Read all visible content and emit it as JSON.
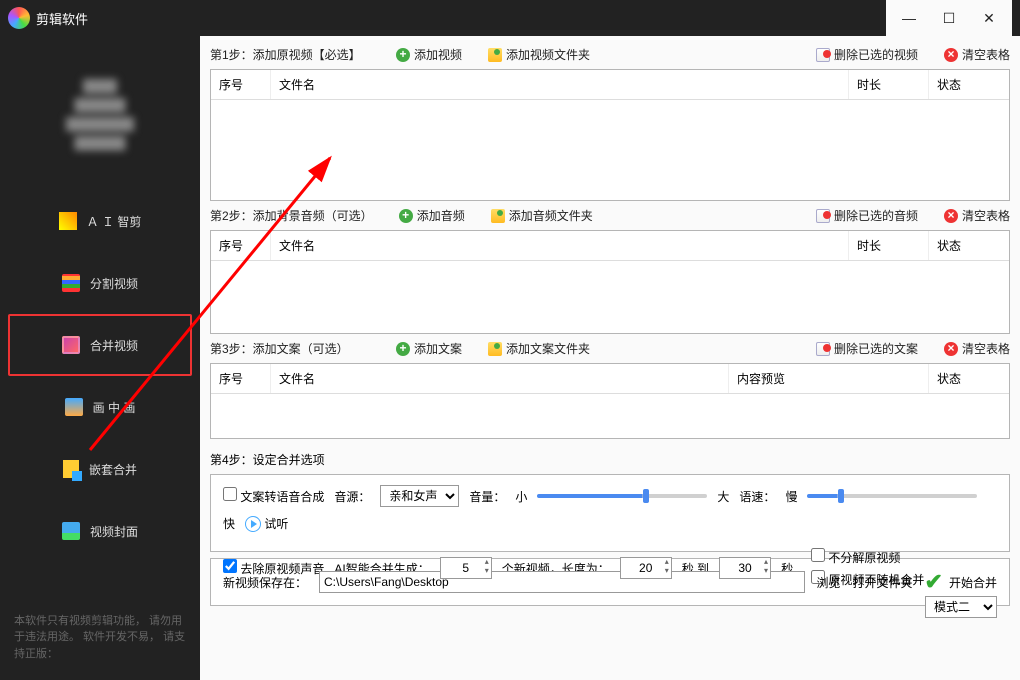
{
  "app": {
    "title": "剪辑软件"
  },
  "window": {
    "min": "—",
    "max": "☐",
    "close": "✕"
  },
  "sidebar": {
    "items": [
      {
        "label": "Ａ Ｉ 智剪"
      },
      {
        "label": "分割视频"
      },
      {
        "label": "合并视频"
      },
      {
        "label": "画 中 画"
      },
      {
        "label": "嵌套合并"
      },
      {
        "label": "视频封面"
      }
    ],
    "footer": "本软件只有视频剪辑功能，\n请勿用于违法用途。\n软件开发不易，\n请支持正版："
  },
  "steps": {
    "s1": {
      "label": "第1步：添加原视频【必选】",
      "add": "添加视频",
      "addFolder": "添加视频文件夹",
      "del": "删除已选的视频",
      "clear": "清空表格",
      "cols": {
        "idx": "序号",
        "name": "文件名",
        "dur": "时长",
        "status": "状态"
      },
      "height": 132
    },
    "s2": {
      "label": "第2步：添加背景音频（可选）",
      "add": "添加音频",
      "addFolder": "添加音频文件夹",
      "del": "删除已选的音频",
      "clear": "清空表格",
      "cols": {
        "idx": "序号",
        "name": "文件名",
        "dur": "时长",
        "status": "状态"
      },
      "height": 104
    },
    "s3": {
      "label": "第3步：添加文案（可选）",
      "add": "添加文案",
      "addFolder": "添加文案文件夹",
      "del": "删除已选的文案",
      "clear": "清空表格",
      "cols": {
        "idx": "序号",
        "name": "文件名",
        "preview": "内容预览",
        "status": "状态"
      },
      "height": 76
    },
    "s4": {
      "label": "第4步：设定合并选项",
      "tts": "文案转语音合成",
      "voiceLabel": "音源：",
      "voice": "亲和女声",
      "volLabel": "音量：",
      "small": "小",
      "big": "大",
      "speedLabel": "语速：",
      "slow": "慢",
      "fast": "快",
      "preview": "试听",
      "removeAudio": "去除原视频声音",
      "aiGen": "AI智能合并生成：",
      "count": "5",
      "countUnit": "个新视频，长度为：",
      "from": "20",
      "secTo": "秒 到",
      "to": "30",
      "sec": "秒",
      "opt1": "不分解原视频",
      "opt2": "原视频不随机合并",
      "modeLabel": "模式二"
    },
    "save": {
      "label": "新视频保存在：",
      "path": "C:\\Users\\Fang\\Desktop",
      "browse": "浏览",
      "openFolder": "打开文件夹",
      "start": "开始合并"
    }
  }
}
